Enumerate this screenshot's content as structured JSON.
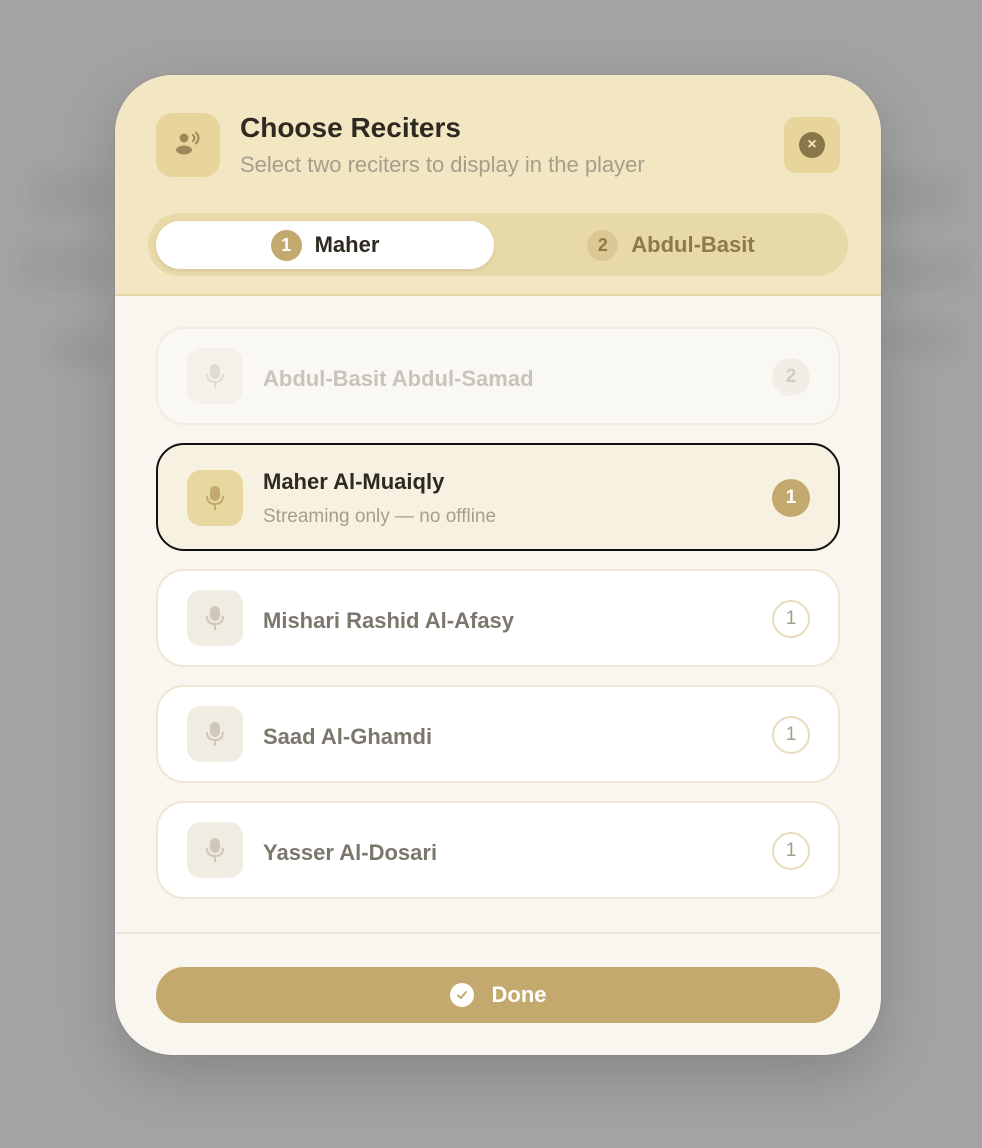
{
  "modal": {
    "title": "Choose Reciters",
    "subtitle": "Select two reciters to display in the player",
    "close_icon": "close-icon"
  },
  "tabs": [
    {
      "num": "1",
      "label": "Maher",
      "active": true
    },
    {
      "num": "2",
      "label": "Abdul-Basit",
      "active": false
    }
  ],
  "reciters": [
    {
      "name": "Abdul-Basit Abdul-Samad",
      "badge": "2",
      "state": "disabled"
    },
    {
      "name": "Maher Al-Muaiqly",
      "subtitle": "Streaming only — no offline",
      "badge": "1",
      "state": "selected"
    },
    {
      "name": "Mishari Rashid Al-Afasy",
      "badge": "1",
      "state": "available"
    },
    {
      "name": "Saad Al-Ghamdi",
      "badge": "1",
      "state": "available"
    },
    {
      "name": "Yasser Al-Dosari",
      "badge": "1",
      "state": "available"
    }
  ],
  "footer": {
    "done_label": "Done"
  },
  "colors": {
    "accent": "#c3a96e",
    "header_bg": "#f2e6c3",
    "text_dark": "#2f2a21"
  }
}
